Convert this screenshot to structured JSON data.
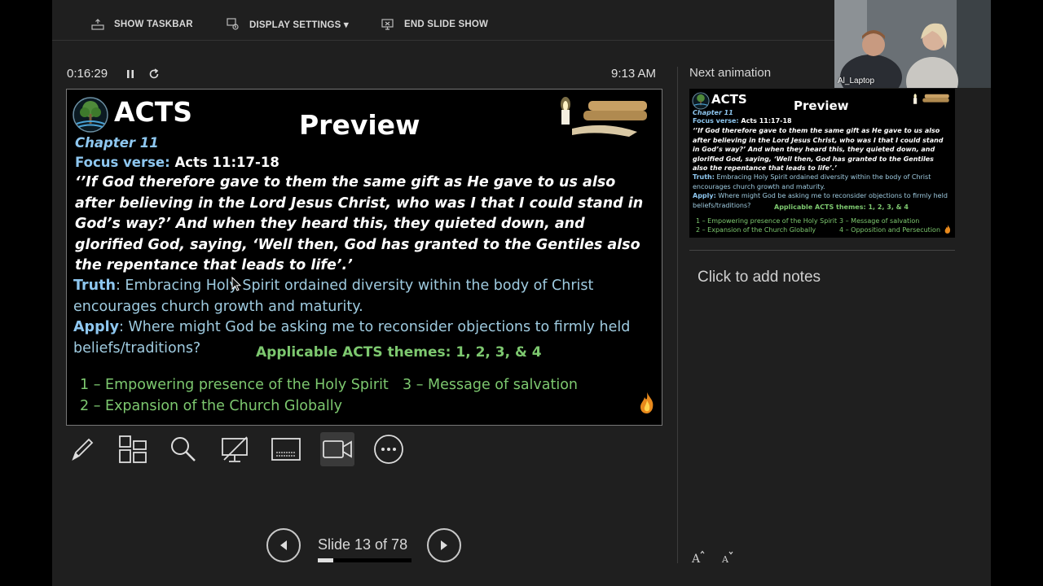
{
  "toolbar": {
    "show_taskbar": "SHOW TASKBAR",
    "display_settings": "DISPLAY SETTINGS ▾",
    "end_slide_show": "END SLIDE SHOW"
  },
  "presenter": {
    "elapsed": "0:16:29",
    "clock": "9:13 AM",
    "slide_counter": "Slide 13 of 78",
    "progress": 0.1667
  },
  "slide": {
    "title": "ACTS",
    "preview": "Preview",
    "chapter": "Chapter 11",
    "focus_label": "Focus verse:",
    "focus_value": "Acts 11:17-18",
    "verse": "‘’If God therefore gave to them the same gift as He gave to us also after believing in the Lord Jesus Christ, who was I that I could stand in God’s way?’ And when they heard this, they quieted down, and glorified God, saying, ‘Well then, God has granted to the Gentiles also the repentance that leads to life’.’",
    "truth_label": "Truth",
    "truth_text": ": Embracing Holy Spirit ordained diversity within the body of Christ encourages church growth and maturity.",
    "apply_label": "Apply",
    "apply_text": ": Where might God be asking me to reconsider objections to firmly held beliefs/traditions?",
    "themes_heading": "Applicable ACTS themes: 1, 2, 3, & 4",
    "themes": [
      "1 – Empowering presence of the Holy Spirit",
      "2 – Expansion of the Church Globally",
      "3 – Message of salvation"
    ]
  },
  "next_slide": {
    "label": "Next animation",
    "title": "ACTS",
    "preview": "Preview",
    "chapter": "Chapter 11",
    "focus_label": "Focus verse:",
    "focus_value": "Acts 11:17-18",
    "verse": "‘’If God therefore gave to them the same gift as He gave to us also after believing in the Lord Jesus Christ, who was I that I could stand in God’s way?’ And when they heard this, they quieted down, and glorified God, saying, ‘Well then, God has granted to the Gentiles also the repentance that leads to life’.’",
    "truth_label": "Truth:",
    "truth_text": " Embracing Holy Spirit ordained diversity within the body of Christ encourages church growth and maturity.",
    "apply_label": "Apply:",
    "apply_text": " Where might God be asking me to reconsider objections to firmly held beliefs/traditions?",
    "themes_heading": "Applicable ACTS themes: 1, 2, 3, & 4",
    "themes": [
      "1 – Empowering presence of the Holy Spirit",
      "2 – Expansion of the Church Globally",
      "3 – Message of salvation",
      "4 – Opposition and Persecution"
    ]
  },
  "notes_placeholder": "Click to add notes",
  "video": {
    "name": "Al_Laptop"
  },
  "colors": {
    "accent_blue": "#8ec7f0",
    "accent_green": "#7dc86f",
    "panel_bg": "#1f1f1f"
  }
}
